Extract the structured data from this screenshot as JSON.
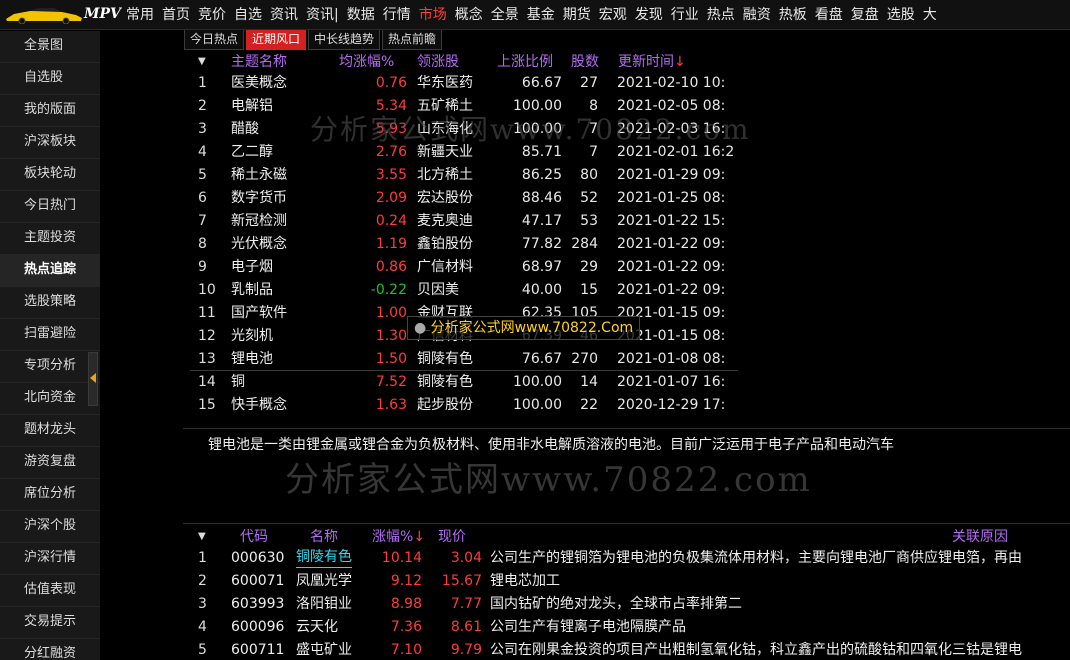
{
  "app": {
    "logo_text": "MPV",
    "menu": [
      "常用",
      "首页",
      "竞价",
      "自选",
      "资讯",
      "资讯|",
      "数据",
      "行情",
      "市场",
      "概念",
      "全景",
      "基金",
      "期货",
      "宏观",
      "发现",
      "行业",
      "热点",
      "融资",
      "热板",
      "看盘",
      "复盘",
      "选股",
      "大"
    ],
    "menu_active_index": 8
  },
  "sidebar": {
    "items": [
      "全景图",
      "自选股",
      "我的版面",
      "沪深板块",
      "板块轮动",
      "今日热门",
      "主题投资",
      "热点追踪",
      "选股策略",
      "扫雷避险",
      "专项分析",
      "北向资金",
      "题材龙头",
      "游资复盘",
      "席位分析",
      "沪深个股",
      "沪深行情",
      "估值表现",
      "交易提示",
      "分红融资"
    ],
    "active_index": 7
  },
  "tabs": [
    "今日热点",
    "近期风口",
    "中长线趋势",
    "热点前瞻"
  ],
  "tabs_active_index": 1,
  "theme_table": {
    "headers": {
      "dropdown": "▼",
      "name": "主题名称",
      "avg_change": "均涨幅%",
      "leader": "领涨股",
      "up_ratio": "上涨比例",
      "count": "股数",
      "updated": "更新时间",
      "sort_arrow": "↓"
    },
    "rows": [
      {
        "idx": "1",
        "name": "医美概念",
        "avg_change": "0.76",
        "dir": "up",
        "leader": "华东医药",
        "up_ratio": "66.67",
        "count": "27",
        "updated": "2021-02-10 10:"
      },
      {
        "idx": "2",
        "name": "电解铝",
        "avg_change": "5.34",
        "dir": "up",
        "leader": "五矿稀土",
        "up_ratio": "100.00",
        "count": "8",
        "updated": "2021-02-05 08:"
      },
      {
        "idx": "3",
        "name": "醋酸",
        "avg_change": "5.93",
        "dir": "up",
        "leader": "山东海化",
        "up_ratio": "100.00",
        "count": "7",
        "updated": "2021-02-03 16:"
      },
      {
        "idx": "4",
        "name": "乙二醇",
        "avg_change": "2.76",
        "dir": "up",
        "leader": "新疆天业",
        "up_ratio": "85.71",
        "count": "7",
        "updated": "2021-02-01 16:2"
      },
      {
        "idx": "5",
        "name": "稀土永磁",
        "avg_change": "3.55",
        "dir": "up",
        "leader": "北方稀土",
        "up_ratio": "86.25",
        "count": "80",
        "updated": "2021-01-29 09:"
      },
      {
        "idx": "6",
        "name": "数字货币",
        "avg_change": "2.09",
        "dir": "up",
        "leader": "宏达股份",
        "up_ratio": "88.46",
        "count": "52",
        "updated": "2021-01-25 08:"
      },
      {
        "idx": "7",
        "name": "新冠检测",
        "avg_change": "0.24",
        "dir": "up",
        "leader": "麦克奥迪",
        "up_ratio": "47.17",
        "count": "53",
        "updated": "2021-01-22 15:"
      },
      {
        "idx": "8",
        "name": "光伏概念",
        "avg_change": "1.19",
        "dir": "up",
        "leader": "鑫铂股份",
        "up_ratio": "77.82",
        "count": "284",
        "updated": "2021-01-22 09:"
      },
      {
        "idx": "9",
        "name": "电子烟",
        "avg_change": "0.86",
        "dir": "up",
        "leader": "广信材料",
        "up_ratio": "68.97",
        "count": "29",
        "updated": "2021-01-22 09:"
      },
      {
        "idx": "10",
        "name": "乳制品",
        "avg_change": "-0.22",
        "dir": "down",
        "leader": "贝因美",
        "up_ratio": "40.00",
        "count": "15",
        "updated": "2021-01-22 09:"
      },
      {
        "idx": "11",
        "name": "国产软件",
        "avg_change": "1.00",
        "dir": "up",
        "leader": "金财互联",
        "up_ratio": "62.35",
        "count": "105",
        "updated": "2021-01-15 09:"
      },
      {
        "idx": "12",
        "name": "光刻机",
        "avg_change": "1.30",
        "dir": "up",
        "leader": "广信材料",
        "up_ratio": "67.39",
        "count": "46",
        "updated": "2021-01-15 08:"
      },
      {
        "idx": "13",
        "name": "锂电池",
        "avg_change": "1.50",
        "dir": "up",
        "leader": "铜陵有色",
        "up_ratio": "76.67",
        "count": "270",
        "updated": "2021-01-08 08:"
      },
      {
        "idx": "14",
        "name": "铜",
        "avg_change": "7.52",
        "dir": "up",
        "leader": "铜陵有色",
        "up_ratio": "100.00",
        "count": "14",
        "updated": "2021-01-07 16:"
      },
      {
        "idx": "15",
        "name": "快手概念",
        "avg_change": "1.63",
        "dir": "up",
        "leader": "起步股份",
        "up_ratio": "100.00",
        "count": "22",
        "updated": "2020-12-29 17:"
      }
    ]
  },
  "description": "锂电池是一类由锂金属或锂合金为负极材料、使用非水电解质溶液的电池。目前广泛运用于电子产品和电动汽车",
  "stock_table": {
    "headers": {
      "dropdown": "▼",
      "code": "代码",
      "name": "名称",
      "change": "涨幅%",
      "sort_arrow": "↓",
      "price": "现价",
      "reason": "关联原因"
    },
    "rows": [
      {
        "idx": "1",
        "code": "000630",
        "name": "铜陵有色",
        "change": "10.14",
        "price": "3.04",
        "reason": "公司生产的锂铜箔为锂电池的负极集流体用材料，主要向锂电池厂商供应锂电箔，再由"
      },
      {
        "idx": "2",
        "code": "600071",
        "name": "凤凰光学",
        "change": "9.12",
        "price": "15.67",
        "reason": "锂电芯加工"
      },
      {
        "idx": "3",
        "code": "603993",
        "name": "洛阳钼业",
        "change": "8.98",
        "price": "7.77",
        "reason": "国内钴矿的绝对龙头，全球市占率排第二"
      },
      {
        "idx": "4",
        "code": "600096",
        "name": "云天化",
        "change": "7.36",
        "price": "8.61",
        "reason": "公司生产有锂离子电池隔膜产品"
      },
      {
        "idx": "5",
        "code": "600711",
        "name": "盛屯矿业",
        "change": "7.10",
        "price": "9.79",
        "reason": "公司在刚果金投资的项目产出粗制氢氧化钴，科立鑫产出的硫酸钴和四氧化三钴是锂电"
      }
    ]
  },
  "watermarks": {
    "top": "分析家公式网www.70822.com",
    "middle": "分析家公式网www.70822.com",
    "badge": "分析家公式网www.70822.Com",
    "badge_dot": "●"
  }
}
